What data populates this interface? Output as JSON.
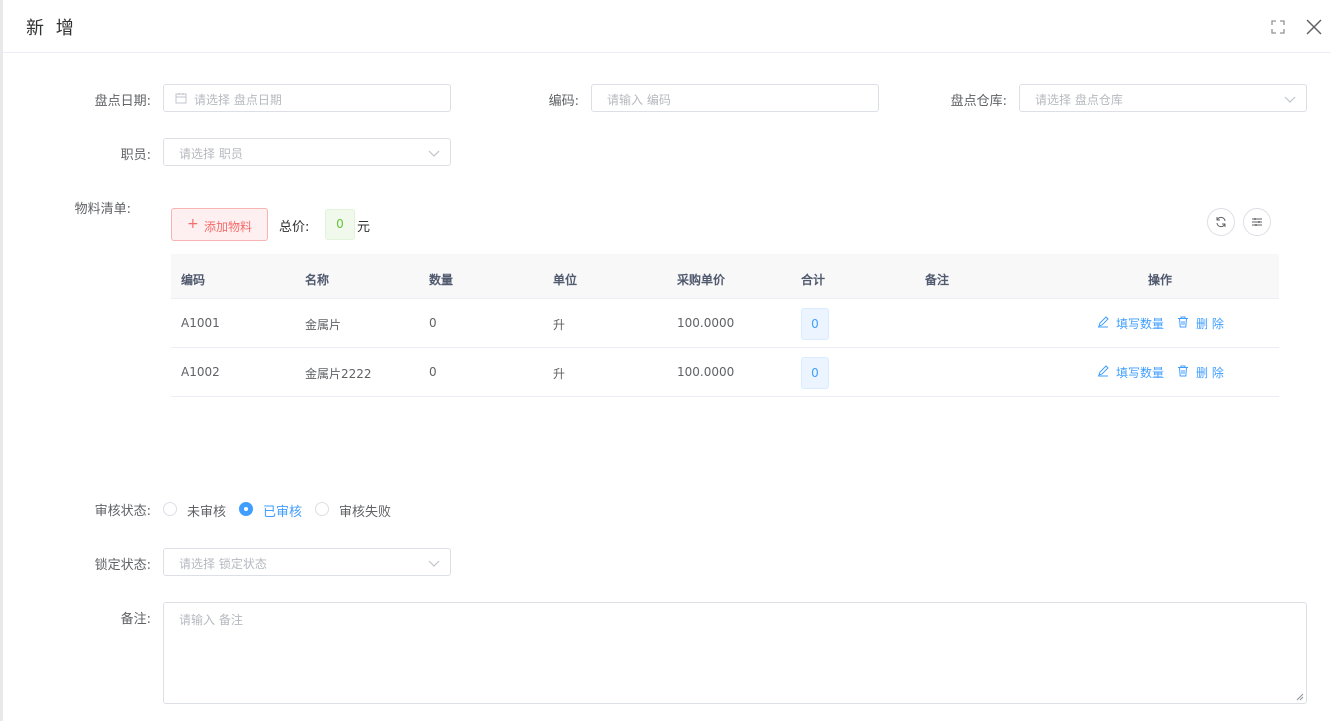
{
  "dialog": {
    "title": "新 增"
  },
  "form": {
    "date": {
      "label": "盘点日期:",
      "placeholder": "请选择 盘点日期"
    },
    "code": {
      "label": "编码:",
      "placeholder": "请输入 编码"
    },
    "warehouse": {
      "label": "盘点仓库:",
      "placeholder": "请选择 盘点仓库"
    },
    "staff": {
      "label": "职员:",
      "placeholder": "请选择 职员"
    },
    "materials": {
      "label": "物料清单:"
    },
    "audit": {
      "label": "审核状态:",
      "options": [
        "未审核",
        "已审核",
        "审核失败"
      ],
      "selected": "已审核"
    },
    "lock": {
      "label": "锁定状态:",
      "placeholder": "请选择 锁定状态"
    },
    "remark": {
      "label": "备注:",
      "placeholder": "请输入 备注"
    }
  },
  "toolbar": {
    "add_label": "添加物料",
    "total_label": "总价:",
    "total_value": "0",
    "total_unit": "元"
  },
  "table": {
    "headers": [
      "编码",
      "名称",
      "数量",
      "单位",
      "采购单价",
      "合计",
      "备注",
      "操作"
    ],
    "rows": [
      {
        "code": "A1001",
        "name": "金属片",
        "qty": "0",
        "unit": "升",
        "price": "100.0000",
        "sum": "0",
        "remark": ""
      },
      {
        "code": "A1002",
        "name": "金属片2222",
        "qty": "0",
        "unit": "升",
        "price": "100.0000",
        "sum": "0",
        "remark": ""
      }
    ],
    "actions": {
      "edit": "填写数量",
      "delete": "删 除"
    }
  },
  "colors": {
    "primary": "#409eff",
    "danger": "#f56c6c",
    "success": "#67c23a",
    "border": "#dcdfe6"
  }
}
